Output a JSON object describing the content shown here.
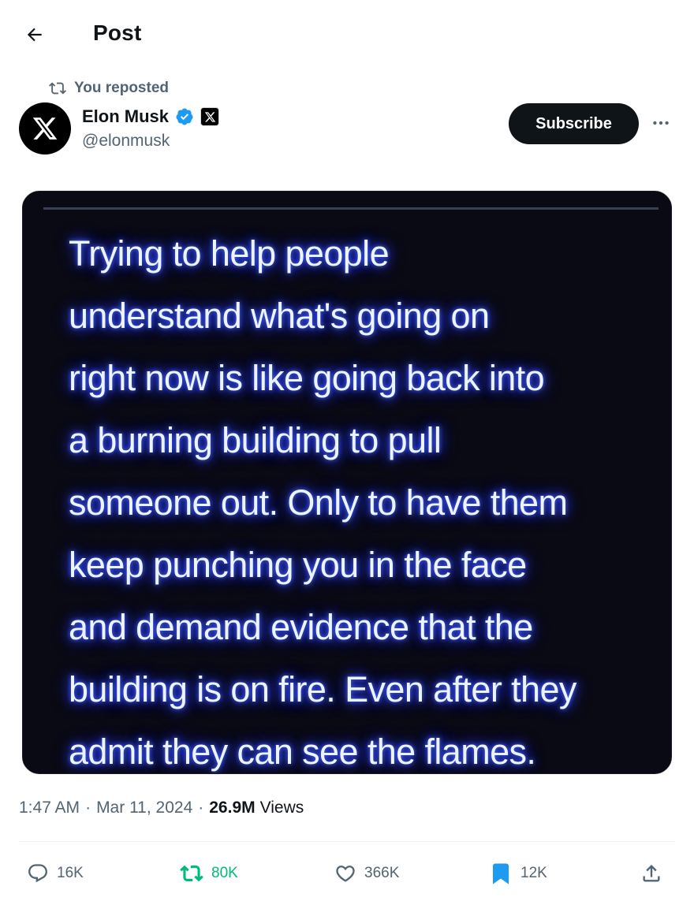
{
  "header": {
    "title": "Post",
    "back_icon": "arrow-left-icon"
  },
  "repost_indicator": {
    "text": "You reposted",
    "icon": "repost-icon"
  },
  "author": {
    "display_name": "Elon Musk",
    "handle": "@elonmusk",
    "verified": true,
    "verified_color": "#1d9bf0",
    "affiliate_badge": "x-logo-icon",
    "avatar": "x-logo-icon"
  },
  "subscribe_button": {
    "label": "Subscribe"
  },
  "more_button": {
    "icon": "more-dots-icon"
  },
  "post": {
    "image_text": "Trying to help people\nunderstand what's going on\nright now is like going back into\na burning building to pull\nsomeone out. Only to have them\nkeep punching you in the face\nand demand evidence that the\nbuilding is on fire. Even after they\nadmit they can see the flames."
  },
  "meta": {
    "time": "1:47 AM",
    "separator": "·",
    "date": "Mar 11, 2024",
    "views_count": "26.9M",
    "views_label": "Views"
  },
  "actions": {
    "reply": {
      "icon": "reply-icon",
      "count": "16K"
    },
    "repost": {
      "icon": "repost-icon",
      "count": "80K",
      "active": true,
      "color": "#00ba7c"
    },
    "like": {
      "icon": "heart-icon",
      "count": "366K"
    },
    "bookmark": {
      "icon": "bookmark-icon",
      "count": "12K",
      "active": true,
      "color": "#1d9bf0"
    },
    "share": {
      "icon": "share-icon"
    }
  }
}
